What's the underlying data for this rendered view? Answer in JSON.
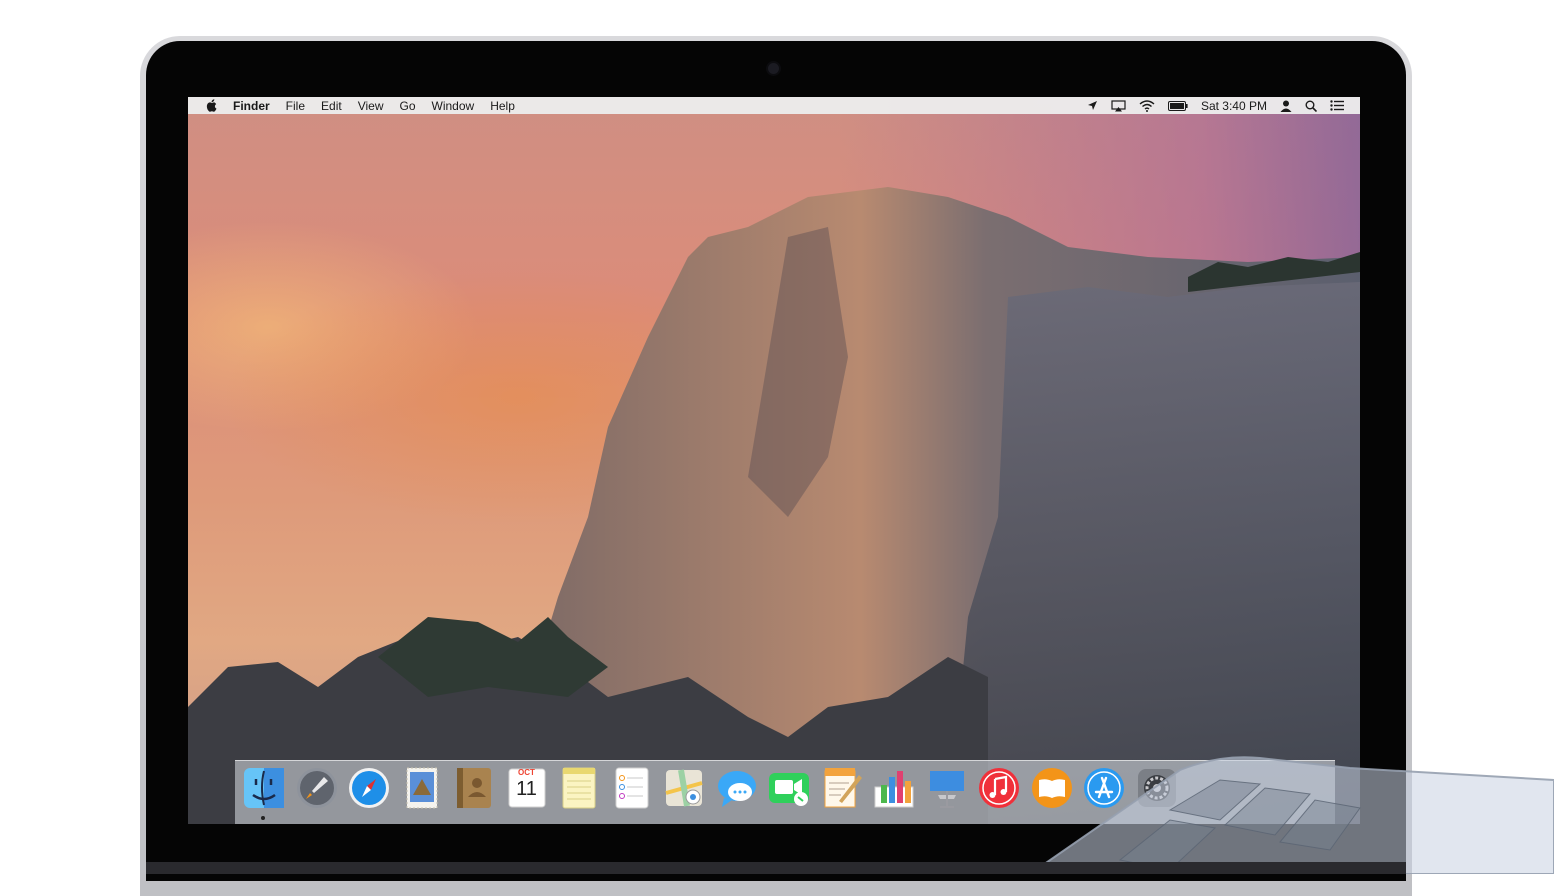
{
  "menubar": {
    "apple_icon": "apple-logo-icon",
    "items": [
      {
        "label": "Finder",
        "bold": true
      },
      {
        "label": "File"
      },
      {
        "label": "Edit"
      },
      {
        "label": "View"
      },
      {
        "label": "Go"
      },
      {
        "label": "Window"
      },
      {
        "label": "Help"
      }
    ],
    "status": {
      "icons": [
        "location-arrow-icon",
        "airplay-icon",
        "wifi-icon",
        "battery-icon",
        "user-icon",
        "spotlight-search-icon",
        "notification-center-icon"
      ],
      "clock": "Sat 3:40 PM"
    }
  },
  "dock": {
    "apps": [
      {
        "name": "Finder",
        "icon": "finder-icon",
        "color": "#3fa9f5"
      },
      {
        "name": "Launchpad",
        "icon": "launchpad-rocket-icon",
        "color": "#8a8f98"
      },
      {
        "name": "Safari",
        "icon": "safari-compass-icon",
        "color": "#1e8fe8"
      },
      {
        "name": "Mail",
        "icon": "mail-stamp-icon",
        "color": "#5a8fd8"
      },
      {
        "name": "Contacts",
        "icon": "contacts-book-icon",
        "color": "#a9834f"
      },
      {
        "name": "Calendar",
        "icon": "calendar-icon",
        "color": "#ffffff",
        "month": "OCT",
        "day": "11"
      },
      {
        "name": "Notes",
        "icon": "notes-icon",
        "color": "#fbe98c"
      },
      {
        "name": "Reminders",
        "icon": "reminders-icon",
        "color": "#ffffff"
      },
      {
        "name": "Maps",
        "icon": "maps-icon",
        "color": "#9cd1a4"
      },
      {
        "name": "Messages",
        "icon": "messages-icon",
        "color": "#3aa8f7"
      },
      {
        "name": "FaceTime",
        "icon": "facetime-icon",
        "color": "#2fd05b"
      },
      {
        "name": "Pages",
        "icon": "pages-icon",
        "color": "#f3a33c"
      },
      {
        "name": "Numbers",
        "icon": "numbers-icon",
        "color": "#4cb84d"
      },
      {
        "name": "Keynote",
        "icon": "keynote-icon",
        "color": "#3d8de0"
      },
      {
        "name": "iTunes",
        "icon": "itunes-note-icon",
        "color": "#f0303a"
      },
      {
        "name": "iBooks",
        "icon": "ibooks-icon",
        "color": "#f39418"
      },
      {
        "name": "App Store",
        "icon": "app-store-icon",
        "color": "#2a9af0"
      },
      {
        "name": "System Preferences",
        "icon": "system-preferences-gear-icon",
        "color": "#7b7f86"
      }
    ]
  }
}
